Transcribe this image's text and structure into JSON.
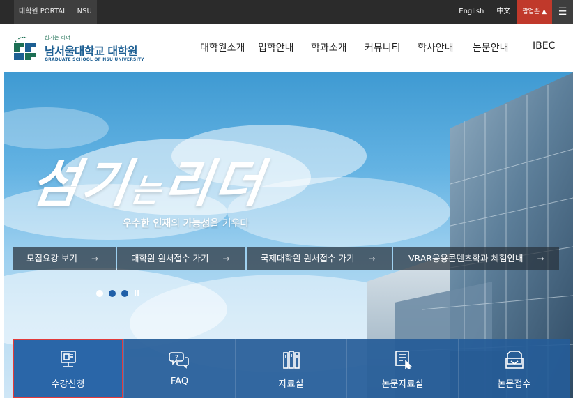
{
  "topbar": {
    "links": [
      "대학원 PORTAL",
      "NSU"
    ],
    "english": "English",
    "chinese": "中文",
    "popup": "팝업존 ▲",
    "menu_icon": "hamburger-icon"
  },
  "header": {
    "logo_tag": "섬기는 리더",
    "logo_name": "남서울대학교 대학원",
    "logo_en": "GRADUATE SCHOOL OF NSU UNIVERSITY",
    "nav": [
      "대학원소개",
      "입학안내",
      "학과소개",
      "커뮤니티",
      "학사안내",
      "논문안내",
      "IBEC"
    ]
  },
  "hero": {
    "slogan_a": "섬기",
    "slogan_b": "는",
    "slogan_c": "리더",
    "sub_1": "우수한 인재",
    "sub_2": "의 ",
    "sub_3": "가능성",
    "sub_4": "을 키우다",
    "buttons": [
      "모집요강 보기",
      "대학원 원서접수 가기",
      "국제대학원 원서접수 가기",
      "VRAR응용콘텐츠학과 체험안내"
    ],
    "arrow": "—→",
    "pause": "II",
    "dot_colors": [
      "#ffffff",
      "#1f5fa8",
      "#1f5fa8"
    ]
  },
  "quick_menu": [
    {
      "label": "수강신청",
      "icon": "monitor-icon"
    },
    {
      "label": "FAQ",
      "icon": "chat-bubbles-icon"
    },
    {
      "label": "자료실",
      "icon": "binders-icon"
    },
    {
      "label": "논문자료실",
      "icon": "document-cursor-icon"
    },
    {
      "label": "논문접수",
      "icon": "envelope-tray-icon"
    }
  ],
  "colors": {
    "topbar": "#2b2b2b",
    "brand_blue": "#1d5f93",
    "quick_bg": "#255c98",
    "highlight": "#e23b3b"
  }
}
